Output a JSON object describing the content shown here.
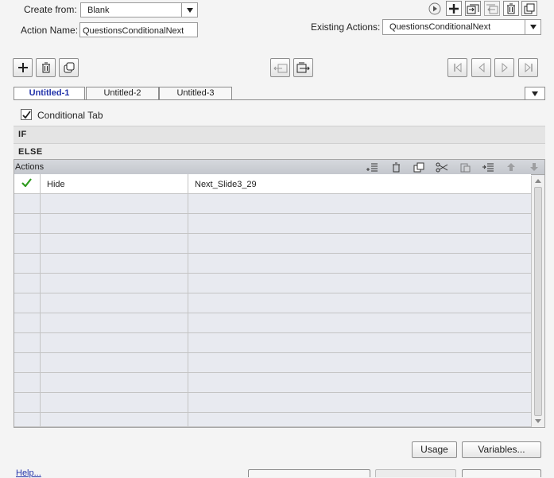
{
  "header": {
    "create_from_label": "Create from:",
    "create_from_value": "Blank",
    "action_name_label": "Action Name:",
    "action_name_value": "QuestionsConditionalNext",
    "existing_actions_label": "Existing Actions:",
    "existing_actions_value": "QuestionsConditionalNext"
  },
  "tabs": [
    {
      "label": "Untitled-1",
      "active": true
    },
    {
      "label": "Untitled-2",
      "active": false
    },
    {
      "label": "Untitled-3",
      "active": false
    }
  ],
  "conditional": {
    "label": "Conditional Tab",
    "checked": true
  },
  "sections": {
    "if_label": "IF",
    "else_label": "ELSE"
  },
  "actions": {
    "header_label": "Actions",
    "rows": [
      {
        "status": "check",
        "action": "Hide",
        "target": "Next_Slide3_29"
      },
      {
        "status": "",
        "action": "",
        "target": ""
      },
      {
        "status": "",
        "action": "",
        "target": ""
      },
      {
        "status": "",
        "action": "",
        "target": ""
      },
      {
        "status": "",
        "action": "",
        "target": ""
      },
      {
        "status": "",
        "action": "",
        "target": ""
      },
      {
        "status": "",
        "action": "",
        "target": ""
      },
      {
        "status": "",
        "action": "",
        "target": ""
      },
      {
        "status": "",
        "action": "",
        "target": ""
      },
      {
        "status": "",
        "action": "",
        "target": ""
      },
      {
        "status": "",
        "action": "",
        "target": ""
      },
      {
        "status": "",
        "action": "",
        "target": ""
      },
      {
        "status": "",
        "action": "",
        "target": ""
      }
    ]
  },
  "buttons": {
    "usage": "Usage",
    "variables": "Variables..."
  },
  "footer": {
    "help": "Help..."
  },
  "colors": {
    "accent": "#2233aa",
    "check": "#2e9b1f",
    "grid_bg": "#e8eaf0",
    "band_bg": "#e4e4e4",
    "actions_header_bg": "#c9ccd2"
  },
  "icons": [
    "preview-icon",
    "add-icon",
    "save-as-icon",
    "import-icon",
    "delete-icon",
    "duplicate-icon",
    "first-icon",
    "prev-icon",
    "next-icon",
    "last-icon",
    "check-icon"
  ]
}
